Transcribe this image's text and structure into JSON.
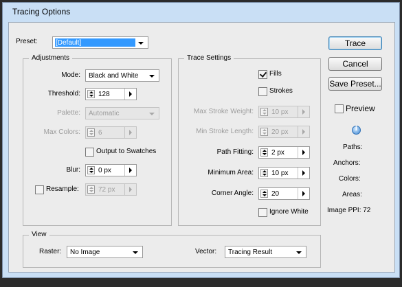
{
  "window": {
    "title": "Tracing Options"
  },
  "preset": {
    "label": "Preset:",
    "value": "[Default]"
  },
  "adjustments": {
    "title": "Adjustments",
    "mode": {
      "label": "Mode:",
      "value": "Black and White"
    },
    "threshold": {
      "label": "Threshold:",
      "value": "128"
    },
    "palette": {
      "label": "Palette:",
      "value": "Automatic"
    },
    "max_colors": {
      "label": "Max Colors:",
      "value": "6"
    },
    "output_to_swatches": {
      "label": "Output to Swatches",
      "checked": false
    },
    "blur": {
      "label": "Blur:",
      "value": "0 px"
    },
    "resample": {
      "label": "Resample:",
      "value": "72 px",
      "checked": false
    }
  },
  "trace_settings": {
    "title": "Trace Settings",
    "fills": {
      "label": "Fills",
      "checked": true
    },
    "strokes": {
      "label": "Strokes",
      "checked": false
    },
    "max_stroke_weight": {
      "label": "Max Stroke Weight:",
      "value": "10 px"
    },
    "min_stroke_length": {
      "label": "Min Stroke Length:",
      "value": "20 px"
    },
    "path_fitting": {
      "label": "Path Fitting:",
      "value": "2 px"
    },
    "minimum_area": {
      "label": "Minimum Area:",
      "value": "10 px"
    },
    "corner_angle": {
      "label": "Corner Angle:",
      "value": "20"
    },
    "ignore_white": {
      "label": "Ignore White",
      "checked": false
    }
  },
  "view": {
    "title": "View",
    "raster": {
      "label": "Raster:",
      "value": "No Image"
    },
    "vector": {
      "label": "Vector:",
      "value": "Tracing Result"
    }
  },
  "buttons": {
    "trace": "Trace",
    "cancel": "Cancel",
    "save_preset": "Save Preset..."
  },
  "preview": {
    "label": "Preview",
    "checked": false
  },
  "stats": {
    "info_icon": "info-icon",
    "paths": "Paths:",
    "anchors": "Anchors:",
    "colors": "Colors:",
    "areas": "Areas:",
    "image_ppi": "Image PPI: 72"
  }
}
